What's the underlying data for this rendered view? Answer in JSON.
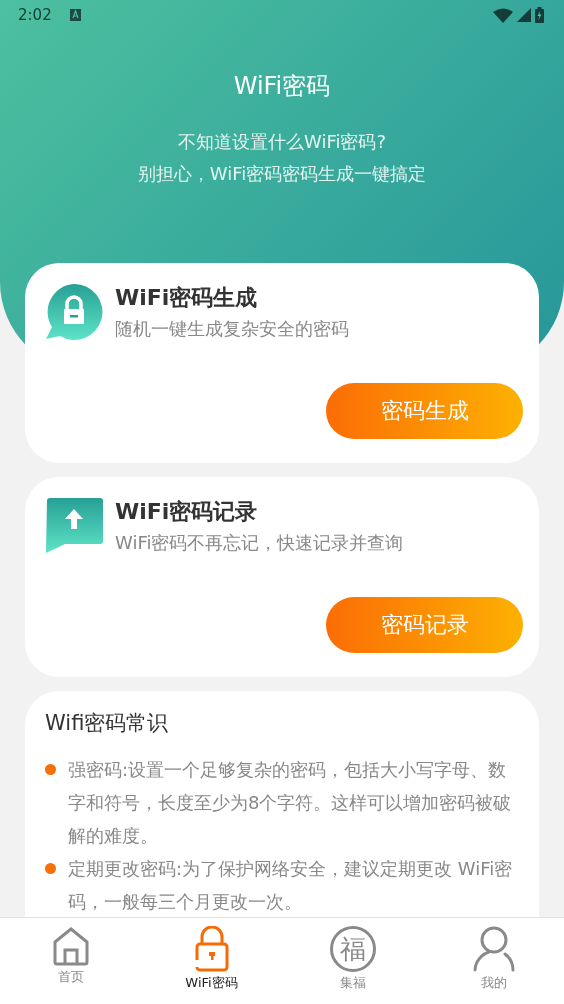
{
  "status_bar": {
    "time": "2:02"
  },
  "header": {
    "title": "WiFi密码",
    "subtitle_lines": [
      "不知道设置什么WiFi密码?",
      "别担心，WiFi密码密码生成一键搞定"
    ]
  },
  "feature_cards": [
    {
      "kind": "lock",
      "title": "WiFi密码生成",
      "description": "随机一键生成复杂安全的密码",
      "button": "密码生成"
    },
    {
      "kind": "upload",
      "title": "WiFi密码记录",
      "description": "WiFi密码不再忘记，快速记录并查询",
      "button": "密码记录"
    }
  ],
  "tips": {
    "title": "Wifi密码常识",
    "items": [
      "强密码:设置一个足够复杂的密码，包括大小写字母、数字和符号，长度至少为8个字符。这样可以增加密码被破解的难度。",
      "定期更改密码:为了保护网络安全，建议定期更改 WiFi密码，一般每三个月更改一次。"
    ]
  },
  "bottom_nav": [
    {
      "kind": "home",
      "label": "首页",
      "selected": false
    },
    {
      "kind": "lock",
      "label": "WiFi密码",
      "selected": true
    },
    {
      "kind": "glyph",
      "glyph": "福",
      "label": "集福",
      "selected": false
    },
    {
      "kind": "person",
      "label": "我的",
      "selected": false
    }
  ]
}
